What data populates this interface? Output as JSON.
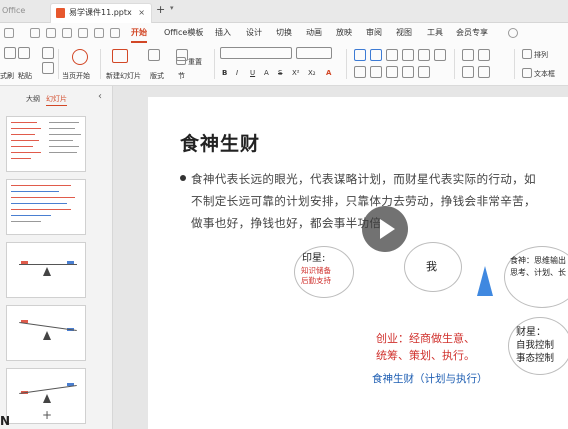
{
  "titlebar": {
    "app_tab": "Office",
    "doc_tab": "易学课件11.pptx",
    "close_glyph": "×",
    "new_tab_glyph": "+",
    "tab_menu_glyph": "▾"
  },
  "menu": {
    "items": [
      "开始",
      "Office模板",
      "插入",
      "设计",
      "切换",
      "动画",
      "放映",
      "审阅",
      "视图",
      "工具",
      "会员专享"
    ],
    "active": "开始"
  },
  "toolbar": {
    "labels": {
      "format": "式刷",
      "paste": "粘贴",
      "from_current": "当页开始",
      "new_slide": "新建幻灯片",
      "layout": "版式",
      "section": "节",
      "reset": "重置",
      "arrange": "排列",
      "textbox": "文本框"
    },
    "font_controls": [
      "B",
      "I",
      "U",
      "A",
      "S",
      "X²",
      "X₂",
      "A"
    ]
  },
  "outline_pane": {
    "tabs": [
      "大纲",
      "幻灯片"
    ],
    "active_tab": "幻灯片",
    "collapse_glyph": "‹",
    "add_glyph": "+"
  },
  "slide": {
    "title": "食神生财",
    "body_lines": [
      "食神代表长远的眼光，代表谋略计划，而财星代表实际的行动，如",
      "不制定长远可靠的计划安排，只靠体力去劳动，挣钱会非常辛苦，",
      "做事也好，挣钱也好，都会事半功倍。"
    ],
    "diagram": {
      "yinxing_title": "印星:",
      "yinxing_detail_1": "知识储备",
      "yinxing_detail_2": "后勤支持",
      "me": "我",
      "shishen_1": "食神：思维输出",
      "shishen_2": "思考、计划、长",
      "chuangye_1": "创业：经商做生意、",
      "chuangye_2": "统筹、策划、执行。",
      "caixing_title": "财星：",
      "caixing_1": "自我控制",
      "caixing_2": "事态控制",
      "caption": "食神生财（计划与执行）"
    },
    "colors": {
      "accent_red": "#d0312d",
      "accent_blue": "#1f5fb3",
      "triangle_blue": "#3f88e0"
    }
  },
  "overlay": {
    "corner_glyph": "N"
  }
}
